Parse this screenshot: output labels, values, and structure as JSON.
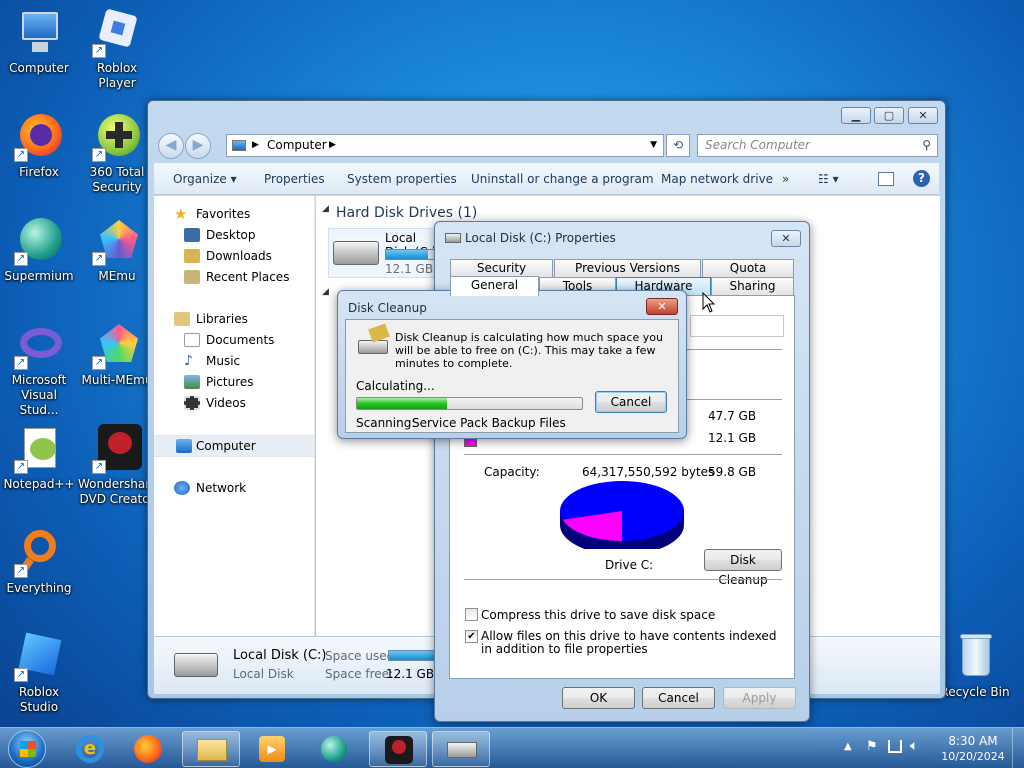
{
  "desktop_icons": [
    {
      "label": "Computer",
      "color": "#3c7fd0"
    },
    {
      "label": "Roblox Player",
      "color": "#3d7de0"
    },
    {
      "label": "Firefox",
      "color": "#ff7a1a"
    },
    {
      "label": "360 Total Security",
      "color": "#8cc63f"
    },
    {
      "label": "Supermium",
      "color": "#1f9e8c"
    },
    {
      "label": "MEmu",
      "color": "#6a5acd"
    },
    {
      "label": "Microsoft Visual Stud...",
      "color": "#7b5cd6"
    },
    {
      "label": "Multi-MEmu",
      "color": "#e04a8a"
    },
    {
      "label": "Notepad++",
      "color": "#8fc54a"
    },
    {
      "label": "Wondershare DVD Creator",
      "color": "#c0202a"
    },
    {
      "label": "Everything",
      "color": "#f07c1a"
    },
    {
      "label": "Roblox Studio",
      "color": "#2a8ae8"
    },
    {
      "label": "Recycle Bin",
      "color": "#a9c8e4"
    }
  ],
  "explorer": {
    "address": "Computer",
    "search_placeholder": "Search Computer",
    "commands": [
      "Organize",
      "Properties",
      "System properties",
      "Uninstall or change a program",
      "Map network drive",
      "»"
    ],
    "nav": {
      "favorites": "Favorites",
      "desktop": "Desktop",
      "downloads": "Downloads",
      "recent": "Recent Places",
      "libraries": "Libraries",
      "documents": "Documents",
      "music": "Music",
      "pictures": "Pictures",
      "videos": "Videos",
      "computer": "Computer",
      "network": "Network"
    },
    "group_header": "Hard Disk Drives (1)",
    "drive_name": "Local Disk (C:)",
    "drive_free": "12.1 GB free of 59.8 GB",
    "drive_used_fraction": 0.8,
    "details": {
      "name": "Local Disk (C:)",
      "type": "Local Disk",
      "used_label": "Space used:",
      "free_label": "Space free:",
      "free_value": "12.1 GB"
    }
  },
  "properties": {
    "title": "Local Disk (C:) Properties",
    "tabs_back": [
      "Security",
      "Previous Versions",
      "Quota"
    ],
    "tabs_front": [
      "General",
      "Tools",
      "Hardware",
      "Sharing"
    ],
    "used_bytes": "47.7 GB",
    "free_bytes": "12.1 GB",
    "capacity_label": "Capacity:",
    "capacity_bytes": "64,317,550,592 bytes",
    "capacity_gb": "59.8 GB",
    "drive_label": "Drive C:",
    "disk_cleanup_button": "Disk Cleanup",
    "compress_label": "Compress this drive to save disk space",
    "index_label": "Allow files on this drive to have contents indexed in addition to file properties",
    "ok": "OK",
    "cancel": "Cancel",
    "apply": "Apply",
    "used_color": "#0000ff",
    "free_color": "#ff00ff"
  },
  "cleanup": {
    "title": "Disk Cleanup",
    "message": "Disk Cleanup is calculating how much space you will be able to free on  (C:). This may take a few minutes to complete.",
    "calculating": "Calculating...",
    "progress_fraction": 0.4,
    "cancel": "Cancel",
    "scanning_label": "Scanning:",
    "scanning_value": "Service Pack Backup Files"
  },
  "taskbar": {
    "time": "8:30 AM",
    "date": "10/20/2024"
  }
}
